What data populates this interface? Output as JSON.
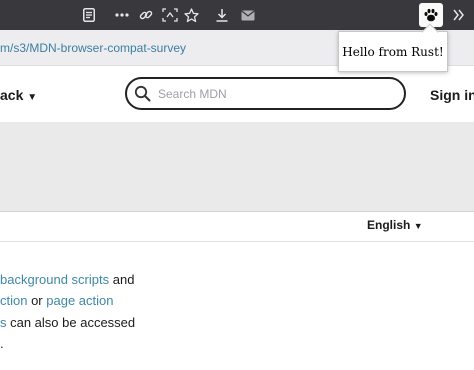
{
  "toolbar": {
    "icons": [
      "reader-view-icon",
      "more-icon",
      "link-icon",
      "screenshot-icon",
      "bookmark-star-icon",
      "download-icon",
      "mail-icon",
      "extension-paw-icon",
      "overflow-chevrons-icon"
    ]
  },
  "popup": {
    "message": "Hello from Rust!"
  },
  "urlbar": {
    "url": "m/s3/MDN-browser-compat-survey"
  },
  "header": {
    "nav_label": "ack",
    "search_placeholder": "Search MDN",
    "signin_label": "Sign in"
  },
  "language": {
    "selected": "English"
  },
  "content": {
    "line1_link": "background scripts",
    "line1_text": " and",
    "line2_link1": "ction",
    "line2_text": " or ",
    "line2_link2": "page action",
    "line3_link": "s",
    "line3_text": " can also be accessed",
    "line4_text": "."
  },
  "colors": {
    "toolbar_bg": "#38383d",
    "url_text": "#3c7ea0",
    "link": "#3f87a6",
    "banner": "#eaeaea"
  }
}
